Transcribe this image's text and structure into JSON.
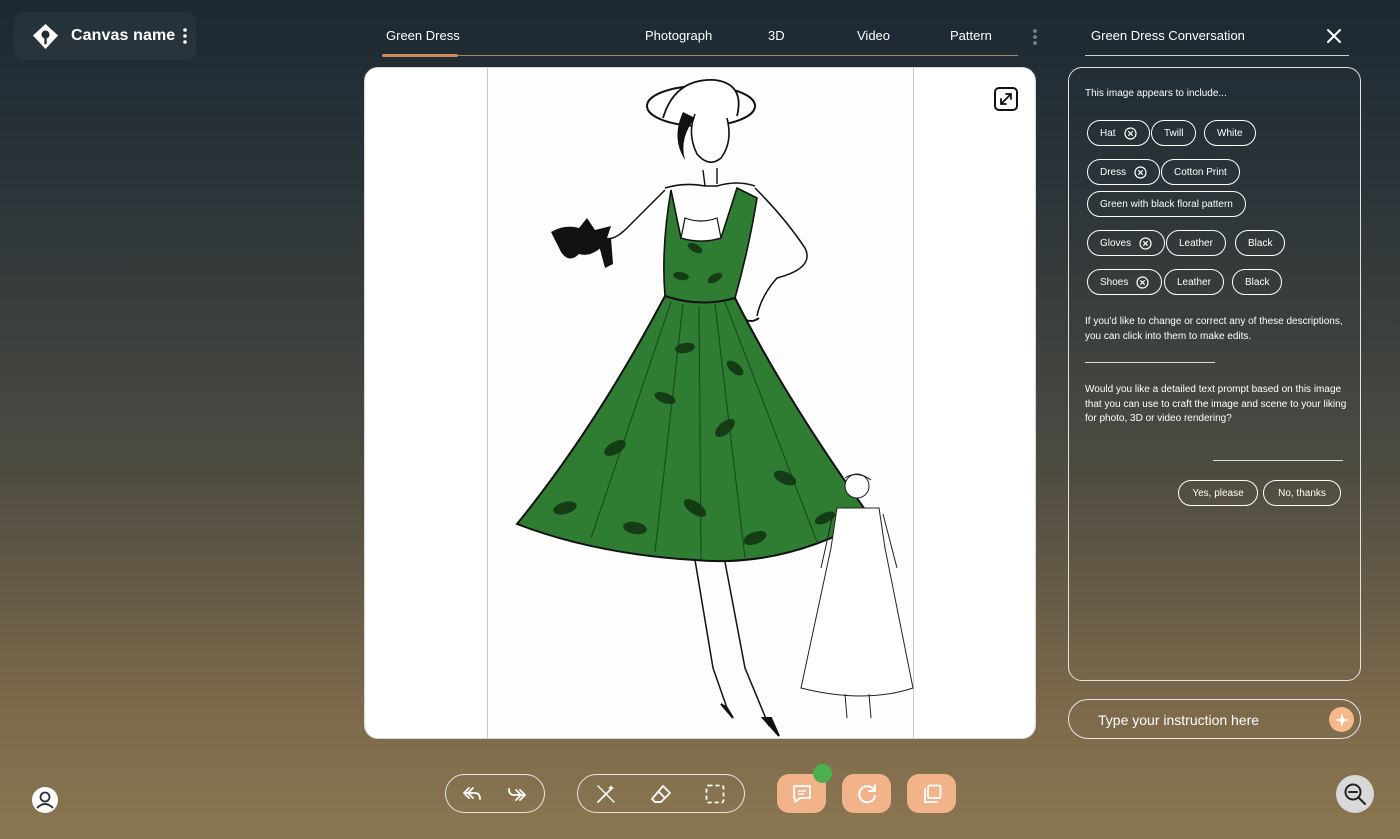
{
  "app": {
    "canvas_name": "Canvas name",
    "logo_icon": "pin-diamond-logo",
    "accent_color": "#f2b28a"
  },
  "tabs": [
    {
      "label": "Green Dress",
      "active": true
    },
    {
      "label": "Photograph",
      "active": false
    },
    {
      "label": "3D",
      "active": false
    },
    {
      "label": "Video",
      "active": false
    },
    {
      "label": "Pattern",
      "active": false
    }
  ],
  "conversation": {
    "title": "Green Dress Conversation",
    "intro": "This image appears to include...",
    "items": [
      {
        "item": "Hat",
        "attributes": [
          "Twill",
          "White"
        ]
      },
      {
        "item": "Dress",
        "attributes": [
          "Cotton Print",
          "Green with black floral pattern"
        ]
      },
      {
        "item": "Gloves",
        "attributes": [
          "Leather",
          "Black"
        ]
      },
      {
        "item": "Shoes",
        "attributes": [
          "Leather",
          "Black"
        ]
      }
    ],
    "edit_hint": "If you'd like to change or correct any of these descriptions, you can click into them to make edits.",
    "prompt_question": "Would you like a detailed text prompt based on this image that you can use to craft the image and scene to your liking for photo, 3D or video rendering?",
    "yes_label": "Yes, please",
    "no_label": "No, thanks"
  },
  "instruction": {
    "placeholder": "Type your instruction here"
  },
  "toolbar": {
    "icons": [
      "undo-icon",
      "redo-icon",
      "magic-wand-icon",
      "eraser-icon",
      "selection-icon",
      "chat-icon",
      "refresh-icon",
      "layers-icon",
      "zoom-out-icon"
    ],
    "chat_has_notification": true
  }
}
